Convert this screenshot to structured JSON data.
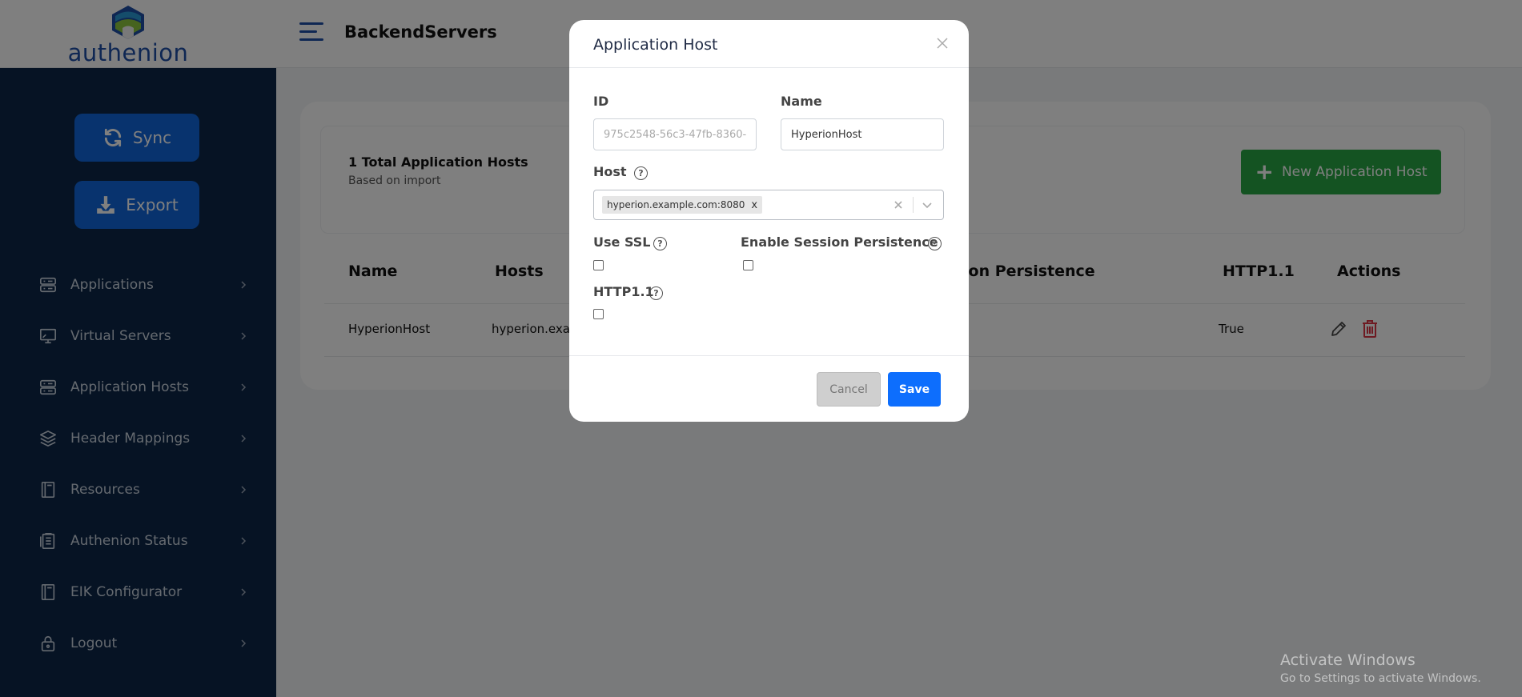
{
  "app": {
    "logo_text": "authenion",
    "page_title": "BackendServers"
  },
  "sidebar": {
    "sync_label": "Sync",
    "export_label": "Export",
    "items": [
      {
        "label": "Applications",
        "icon": "applications-icon"
      },
      {
        "label": "Virtual Servers",
        "icon": "monitor-icon"
      },
      {
        "label": "Application Hosts",
        "icon": "server-icon"
      },
      {
        "label": "Header Mappings",
        "icon": "layers-icon"
      },
      {
        "label": "Resources",
        "icon": "book-icon"
      },
      {
        "label": "Authenion Status",
        "icon": "clipboard-icon"
      },
      {
        "label": "EIK Configurator",
        "icon": "book-icon"
      },
      {
        "label": "Logout",
        "icon": "lock-icon"
      }
    ]
  },
  "main": {
    "summary_count": "1 Total Application Hosts",
    "summary_sub": "Based on import",
    "new_button_label": "New Application Host",
    "table": {
      "headers": [
        "Name",
        "Hosts",
        "ion Persistence",
        "HTTP1.1",
        "Actions"
      ],
      "rows": [
        {
          "name": "HyperionHost",
          "hosts": "hyperion.exam",
          "http11": "True"
        }
      ]
    }
  },
  "modal": {
    "title": "Application Host",
    "id_label": "ID",
    "id_value": "975c2548-56c3-47fb-8360-",
    "name_label": "Name",
    "name_value": "HyperionHost",
    "host_label": "Host",
    "host_chip": "hyperion.example.com:8080",
    "chip_remove": "x",
    "help_glyph": "?",
    "use_ssl_label": "Use SSL",
    "session_label": "Enable Session Persistence",
    "http11_label": "HTTP1.1",
    "use_ssl_checked": false,
    "session_checked": false,
    "http11_checked": false,
    "cancel_label": "Cancel",
    "save_label": "Save"
  },
  "watermark": {
    "line1": "Activate Windows",
    "line2": "Go to Settings to activate Windows."
  },
  "colors": {
    "sidebar_bg": "#0d2748",
    "primary": "#1166dd",
    "success": "#29a745",
    "danger": "#dc3545",
    "save": "#0d6efd"
  }
}
